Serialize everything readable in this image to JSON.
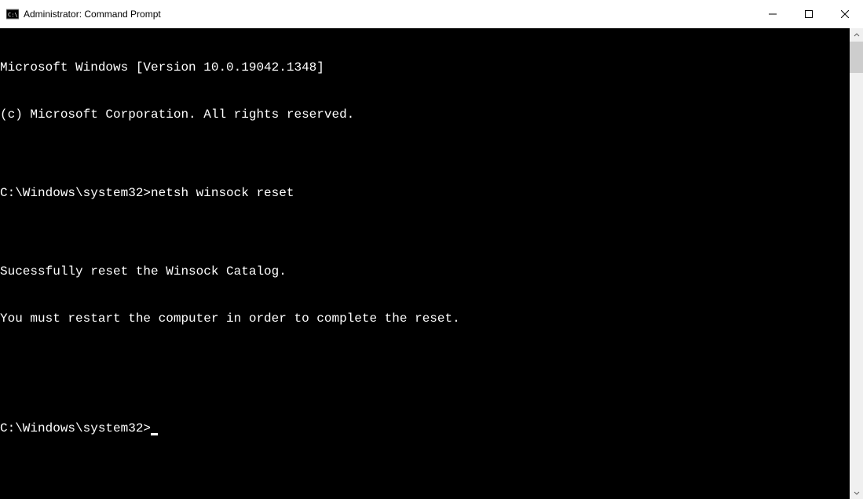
{
  "window": {
    "title": "Administrator: Command Prompt"
  },
  "terminal": {
    "lines": [
      "Microsoft Windows [Version 10.0.19042.1348]",
      "(c) Microsoft Corporation. All rights reserved.",
      "",
      "C:\\Windows\\system32>netsh winsock reset",
      "",
      "Sucessfully reset the Winsock Catalog.",
      "You must restart the computer in order to complete the reset.",
      "",
      ""
    ],
    "prompt": "C:\\Windows\\system32>"
  }
}
